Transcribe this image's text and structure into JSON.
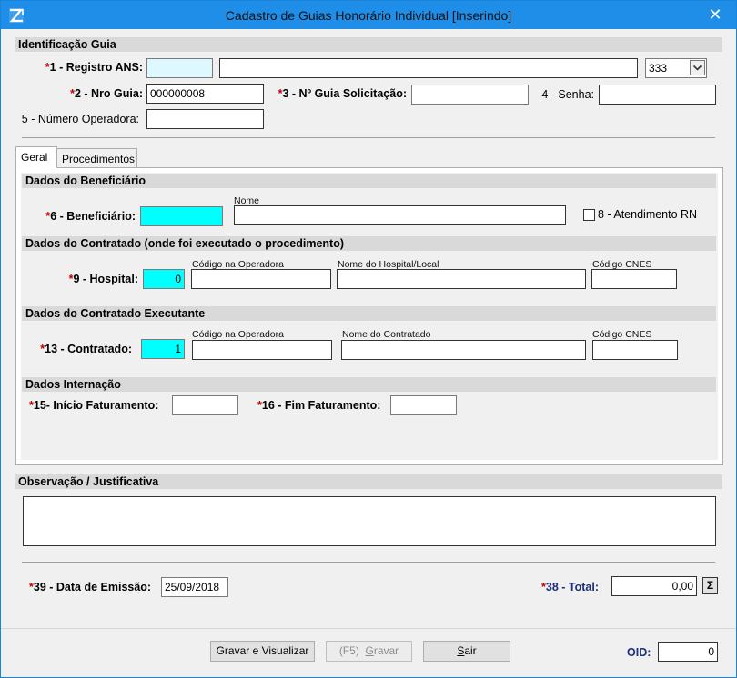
{
  "window": {
    "title": "Cadastro de Guias Honorário Individual [Inserindo]",
    "close_symbol": "✕"
  },
  "identificacao": {
    "section_title": "Identificação Guia",
    "registro_ans": {
      "num": "1 - Registro ANS:",
      "value": "",
      "name_value": "",
      "select_value": "333"
    },
    "nro_guia": {
      "num": "2 - Nro Guia:",
      "value": "000000008"
    },
    "guia_solicitacao": {
      "num": "3 - Nº Guia Solicitação:",
      "value": ""
    },
    "senha": {
      "label": "4 - Senha:",
      "value": ""
    },
    "numero_operadora": {
      "label": "5 - Número Operadora:",
      "value": ""
    }
  },
  "tabs": [
    {
      "label": "Geral",
      "active": true
    },
    {
      "label": "Procedimentos",
      "active": false
    }
  ],
  "beneficiario": {
    "section_title": "Dados do Beneficiário",
    "label": "6 - Beneficiário:",
    "value": "",
    "nome_caption": "Nome",
    "nome_value": "",
    "rn_label": "8 - Atendimento RN"
  },
  "contratado": {
    "section_title": "Dados do Contratado (onde foi executado o procedimento)",
    "label": "9 - Hospital:",
    "value": "0",
    "codigo_caption": "Código na Operadora",
    "nome_caption": "Nome do Hospital/Local",
    "cnes_caption": "Código CNES"
  },
  "executante": {
    "section_title": "Dados do Contratado Executante",
    "label": "13 - Contratado:",
    "value": "1",
    "codigo_caption": "Código na Operadora",
    "nome_caption": "Nome do Contratado",
    "cnes_caption": "Código CNES"
  },
  "internacao": {
    "section_title": "Dados Internação",
    "inicio_label": "15- Início Faturamento:",
    "fim_label": "16 - Fim Faturamento:"
  },
  "observacao": {
    "section_title": "Observação / Justificativa",
    "value": ""
  },
  "emissao": {
    "label": "39 - Data de Emissão:",
    "value": "25/09/2018"
  },
  "total": {
    "label": "38 - Total:",
    "value": "0,00",
    "sum_symbol": "Σ"
  },
  "footer": {
    "gravar_visualizar": "Gravar e Visualizar",
    "f5_prefix": "(F5)  ",
    "gravar_ul": "G",
    "gravar_rest": "ravar",
    "sair_ul": "S",
    "sair_rest": "air",
    "oid_label": "OID:",
    "oid_value": "0"
  },
  "required_mark": "*",
  "colors": {
    "titlebar": "#1e8ee8",
    "required": "#c00000",
    "highlight": "#00ffff",
    "total_label": "#1a2f7a"
  }
}
